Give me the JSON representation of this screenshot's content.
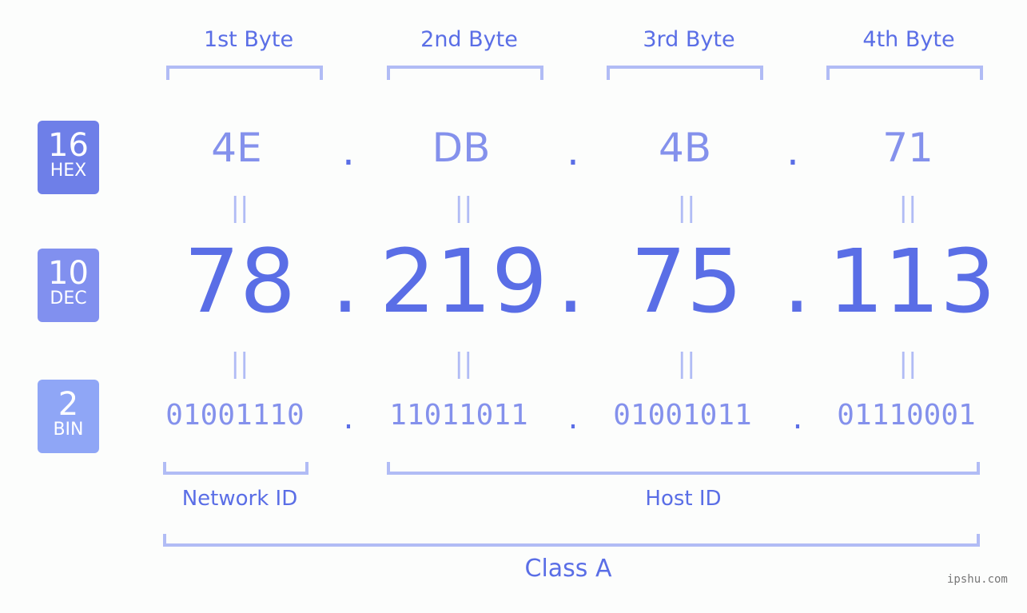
{
  "bytes": [
    {
      "label": "1st Byte",
      "hex": "4E",
      "dec": "78",
      "bin": "01001110"
    },
    {
      "label": "2nd Byte",
      "hex": "DB",
      "dec": "219",
      "bin": "11011011"
    },
    {
      "label": "3rd Byte",
      "hex": "4B",
      "dec": "75",
      "bin": "01001011"
    },
    {
      "label": "4th Byte",
      "hex": "71",
      "dec": "113",
      "bin": "01110001"
    }
  ],
  "separator": ".",
  "equals": "||",
  "badges": {
    "hex": {
      "num": "16",
      "label": "HEX",
      "color": "#6e7fe8"
    },
    "dec": {
      "num": "10",
      "label": "DEC",
      "color": "#8190ef"
    },
    "bin": {
      "num": "2",
      "label": "BIN",
      "color": "#8fa6f6"
    }
  },
  "network_id_label": "Network ID",
  "host_id_label": "Host ID",
  "class_label": "Class A",
  "watermark": "ipshu.com",
  "colors": {
    "accent": "#5a6ee6",
    "light": "#8491ec",
    "bracket": "#b1bcf5"
  }
}
